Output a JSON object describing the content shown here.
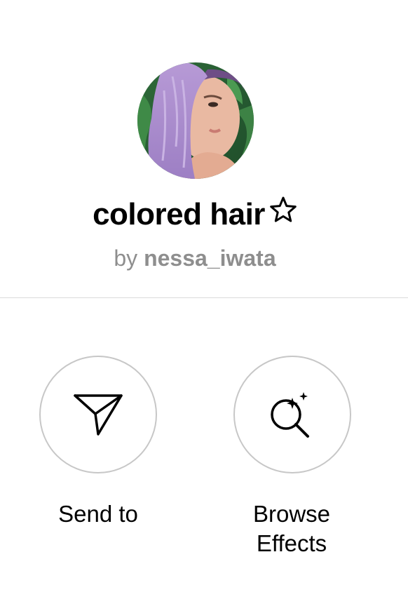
{
  "effect": {
    "title": "colored hair",
    "byline_prefix": "by",
    "author": "nessa_iwata",
    "favorite_icon": "star-outline-icon"
  },
  "actions": [
    {
      "label": "Send to",
      "icon": "paper-plane-icon"
    },
    {
      "label": "Browse\nEffects",
      "icon": "sparkle-search-icon"
    }
  ],
  "colors": {
    "text": "#000000",
    "secondary_text": "#8e8e8e",
    "divider": "#dbdbdb",
    "button_border": "#c7c7c7"
  }
}
